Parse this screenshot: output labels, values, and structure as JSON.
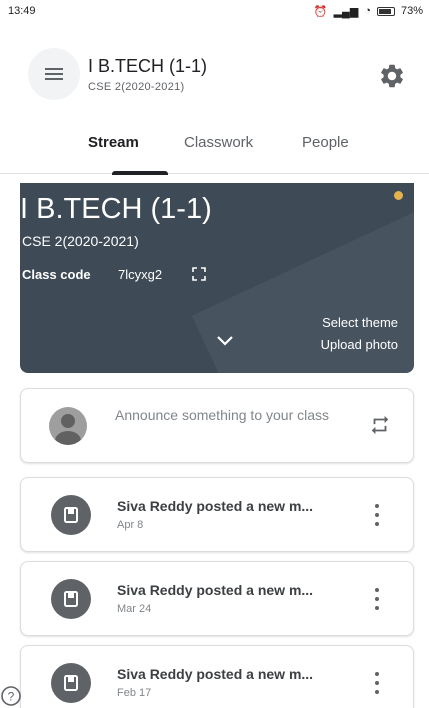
{
  "status_bar": {
    "time": "13:49",
    "battery": "73%"
  },
  "header": {
    "title": "I B.TECH (1-1)",
    "subtitle": "CSE 2(2020-2021)"
  },
  "tabs": [
    {
      "label": "Stream"
    },
    {
      "label": "Classwork"
    },
    {
      "label": "People"
    }
  ],
  "banner": {
    "title": "I B.TECH (1-1)",
    "subtitle": "CSE 2(2020-2021)",
    "class_code_label": "Class code",
    "class_code": "7lcyxg2",
    "select_theme": "Select theme",
    "upload_photo": "Upload photo",
    "theme_color": "#3e4a56",
    "accent_dot_color": "#e2b24d"
  },
  "announce": {
    "placeholder": "Announce something to your class"
  },
  "posts": [
    {
      "title": "Siva Reddy posted a new m...",
      "date": "Apr 8"
    },
    {
      "title": "Siva Reddy posted a new m...",
      "date": "Mar 24"
    },
    {
      "title": "Siva Reddy posted a new m...",
      "date": "Feb 17"
    }
  ]
}
